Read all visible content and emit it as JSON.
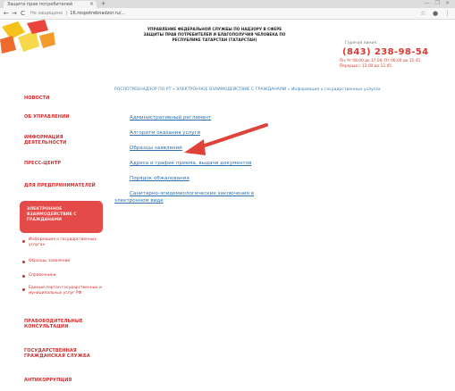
{
  "browser": {
    "tab_title": "Защита прав потребителей",
    "tab_close": "×",
    "new_tab": "+",
    "window_controls": "— ❐ ✕",
    "back": "←",
    "forward": "→",
    "reload": "C",
    "address_security": "Не защищено",
    "address_url": "16.rospotrebnadzor.ru/...",
    "menu_star": "☆",
    "menu_dots": "⋮",
    "menu_profile": "●"
  },
  "header": {
    "org_name": "УПРАВЛЕНИЕ ФЕДЕРАЛЬНОЙ СЛУЖБЫ ПО НАДЗОРУ В СФЕРЕ ЗАЩИТЫ ПРАВ ПОТРЕБИТЕЛЕЙ И БЛАГОПОЛУЧИЯ ЧЕЛОВЕКА ПО РЕСПУБЛИКЕ ТАТАРСТАН (ТАТАРСТАН)",
    "hotline_label": "Горячая линия",
    "phone": "(843) 238-98-54",
    "hours_line1": "Пн-Чт 08.00 до 17.00, Пт 08.00 до 15.45",
    "hours_line2": "Перерыв с 12.00 до 12.45"
  },
  "sidebar": {
    "items": [
      {
        "label": "НОВОСТИ"
      },
      {
        "label": "ОБ УПРАВЛЕНИИ"
      },
      {
        "label": "ИНФОРМАЦИЯ ДЕЯТЕЛЬНОСТИ"
      },
      {
        "label": "ПРЕСС-ЦЕНТР"
      },
      {
        "label": "ДЛЯ ПРЕДПРИНИМАТЕЛЕЙ"
      }
    ],
    "active": "ЭЛЕКТРОННОЕ ВЗАИМОДЕЙСТВИЕ С ГРАЖДАНАМИ",
    "sub_items": [
      {
        "label": "Информация о государственных услугах"
      },
      {
        "label": "Образцы заявлений"
      },
      {
        "label": "Справочники"
      },
      {
        "label": "Единый портал государственных и муниципальных услуг РФ"
      }
    ],
    "bottom_items": [
      {
        "label": "ПРАВОВОДИТЕЛЬНЫЕ КОНСУЛЬТАЦИИ"
      },
      {
        "label": "ГОСУДАРСТВЕННАЯ ГРАЖДАНСКАЯ СЛУЖБА"
      },
      {
        "label": "АНТИКОРРУПЦИЯ"
      }
    ]
  },
  "breadcrumb": "РОСПОТРЕБНАДЗОР ПО РТ » ЭЛЕКТРОННОЕ ВЗАИМОДЕЙСТВИЕ С ГРАЖДАНАМИ » Информация о государственных услугах",
  "content": {
    "links": [
      {
        "label": "Административный регламент"
      },
      {
        "label": "Алгоритм оказания услуги"
      },
      {
        "label": "Образцы заявлений"
      },
      {
        "label": "Адреса и график приема, выдачи документов"
      },
      {
        "label": "Порядок обжалования"
      },
      {
        "label": "Санитарно-эпидемиологические заключения в"
      },
      {
        "label": "электронном виде"
      }
    ]
  },
  "colors": {
    "accent_red": "#d22d2d",
    "active_bg": "#e34a48",
    "link_blue": "#2f6fb0",
    "arrow": "#e0413a"
  }
}
